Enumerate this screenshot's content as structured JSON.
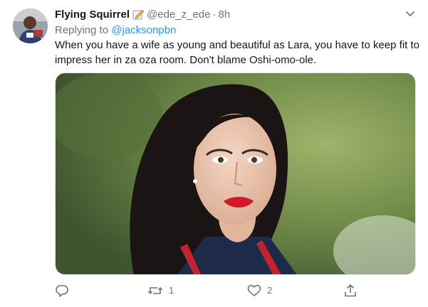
{
  "tweet": {
    "display_name": "Flying Squirrel",
    "handle": "@ede_z_ede",
    "separator": "·",
    "time": "8h",
    "replying_prefix": "Replying to",
    "replying_to": "@jacksonpbn",
    "text": "When you have a wife as young and beautiful as Lara, you have to keep fit to impress her in za oza room. Don't blame Oshi-omo-ole.",
    "badge_icon": "pencil-emoji-icon",
    "menu_icon": "chevron-down-icon"
  },
  "actions": {
    "reply": {
      "icon": "reply-icon",
      "count": ""
    },
    "retweet": {
      "icon": "retweet-icon",
      "count": "1"
    },
    "like": {
      "icon": "heart-icon",
      "count": "2"
    },
    "share": {
      "icon": "share-icon",
      "count": ""
    }
  },
  "colors": {
    "accent": "#1da1f2",
    "secondary_text": "#657786",
    "primary_text": "#14171a"
  }
}
